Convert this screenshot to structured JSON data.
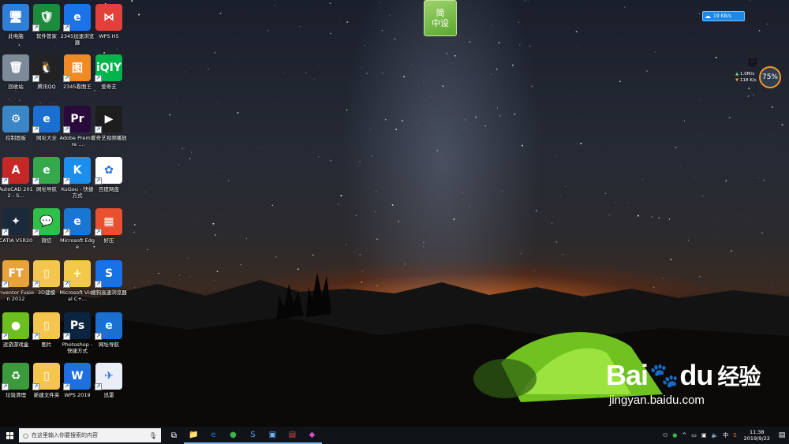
{
  "desktop": {
    "icons": [
      {
        "label": "此电脑",
        "icon": "computer-icon",
        "color": "#2f7fd8",
        "glyph": "🖥",
        "shortcut": false
      },
      {
        "label": "软件管家",
        "icon": "software-manager-icon",
        "color": "#1d8b3c",
        "glyph": "🛡",
        "shortcut": true
      },
      {
        "label": "2345加速浏览器",
        "icon": "browser-2345-icon",
        "color": "#1a73e8",
        "glyph": "e",
        "shortcut": true
      },
      {
        "label": "WPS H5",
        "icon": "wps-h5-icon",
        "color": "#e2413b",
        "glyph": "⋈",
        "shortcut": false
      },
      {
        "label": "回收站",
        "icon": "recycle-bin-icon",
        "color": "#7d8b99",
        "glyph": "🗑",
        "shortcut": false
      },
      {
        "label": "腾讯QQ",
        "icon": "qq-icon",
        "color": "#222222",
        "glyph": "🐧",
        "shortcut": true
      },
      {
        "label": "2345看图王",
        "icon": "image-viewer-2345-icon",
        "color": "#f08a24",
        "glyph": "图",
        "shortcut": true
      },
      {
        "label": "爱奇艺",
        "icon": "iqiyi-icon",
        "color": "#00b34a",
        "glyph": "iQIY",
        "shortcut": true
      },
      {
        "label": "控制面板",
        "icon": "control-panel-icon",
        "color": "#3b86c6",
        "glyph": "⚙",
        "shortcut": false
      },
      {
        "label": "网址大全",
        "icon": "ie-icon",
        "color": "#1a6fd0",
        "glyph": "e",
        "shortcut": true
      },
      {
        "label": "Adobe Premiere ...",
        "icon": "premiere-icon",
        "color": "#2a0a3a",
        "glyph": "Pr",
        "shortcut": true
      },
      {
        "label": "爱奇艺视频播放",
        "icon": "iqiyi-player-icon",
        "color": "#1d1d1d",
        "glyph": "▶",
        "shortcut": true
      },
      {
        "label": "AutoCAD 2012 - S...",
        "icon": "autocad-icon",
        "color": "#c62828",
        "glyph": "A",
        "shortcut": true
      },
      {
        "label": "网址导航",
        "icon": "web-nav-icon",
        "color": "#35a84c",
        "glyph": "e",
        "shortcut": true
      },
      {
        "label": "KuGou - 快捷方式",
        "icon": "kugou-icon",
        "color": "#1c8ef0",
        "glyph": "K",
        "shortcut": true
      },
      {
        "label": "百度网盘",
        "icon": "baidu-netdisk-icon",
        "color": "#ffffff",
        "glyph": "✿",
        "shortcut": true
      },
      {
        "label": "CATIA V5R20",
        "icon": "catia-icon",
        "color": "#1b2a3a",
        "glyph": "✦",
        "shortcut": true
      },
      {
        "label": "微信",
        "icon": "wechat-icon",
        "color": "#2ec04a",
        "glyph": "💬",
        "shortcut": true
      },
      {
        "label": "Microsoft Edge",
        "icon": "edge-icon",
        "color": "#1976d2",
        "glyph": "e",
        "shortcut": true
      },
      {
        "label": "好压",
        "icon": "haozip-icon",
        "color": "#e8502f",
        "glyph": "▦",
        "shortcut": true
      },
      {
        "label": "Inventor Fusion 2012",
        "icon": "inventor-icon",
        "color": "#e7a33a",
        "glyph": "FT",
        "shortcut": true
      },
      {
        "label": "3D建模",
        "icon": "folder-icon",
        "color": "#f4c64f",
        "glyph": "▯",
        "shortcut": true
      },
      {
        "label": "Microsoft Visual C+...",
        "icon": "visual-cpp-icon",
        "color": "#f3c94a",
        "glyph": "+",
        "shortcut": true
      },
      {
        "label": "搜狗高速浏览器",
        "icon": "sogou-browser-icon",
        "color": "#1672e6",
        "glyph": "S",
        "shortcut": true
      },
      {
        "label": "逗游游戏盒",
        "icon": "game-box-icon",
        "color": "#6bbf1f",
        "glyph": "●",
        "shortcut": true
      },
      {
        "label": "图片",
        "icon": "pictures-folder-icon",
        "color": "#f4c64f",
        "glyph": "▯",
        "shortcut": true
      },
      {
        "label": "Photoshop - 快捷方式",
        "icon": "photoshop-icon",
        "color": "#0b2440",
        "glyph": "Ps",
        "shortcut": true
      },
      {
        "label": "网址导航",
        "icon": "web-nav-ie-icon",
        "color": "#1a6fd0",
        "glyph": "e",
        "shortcut": true
      },
      {
        "label": "垃圾清理",
        "icon": "junk-cleaner-icon",
        "color": "#3b9a3b",
        "glyph": "♻",
        "shortcut": true
      },
      {
        "label": "新建文件夹",
        "icon": "new-folder-icon",
        "color": "#f4c64f",
        "glyph": "▯",
        "shortcut": true
      },
      {
        "label": "WPS 2019",
        "icon": "wps-2019-icon",
        "color": "#1e6fe0",
        "glyph": "W",
        "shortcut": true
      },
      {
        "label": "迅雷",
        "icon": "xunlei-icon",
        "color": "#e9eef7",
        "glyph": "✈",
        "shortcut": true
      }
    ]
  },
  "top_widget": {
    "line1": "简",
    "line2": "中设"
  },
  "net_float": {
    "speed": "19 KB/s"
  },
  "speed_widget": {
    "up": "1.0M/s",
    "down": "118 K/s",
    "percent": "75%"
  },
  "watermark": {
    "logo_left": "Bai",
    "logo_right": "du",
    "cn": "经验",
    "url": "jingyan.baidu.com"
  },
  "taskbar": {
    "search_placeholder": "在这里输入你要搜索的内容",
    "apps": [
      {
        "icon": "task-view-icon",
        "glyph": "⧉",
        "color": "#ffffff",
        "active": false
      },
      {
        "icon": "file-explorer-icon",
        "glyph": "📁",
        "color": "#f4c64f",
        "active": true
      },
      {
        "icon": "browser-2345-taskbar-icon",
        "glyph": "e",
        "color": "#1a73e8",
        "active": true
      },
      {
        "icon": "green-app-icon",
        "glyph": "●",
        "color": "#3bb54a",
        "active": true
      },
      {
        "icon": "sogou-taskbar-icon",
        "glyph": "S",
        "color": "#4aa3ff",
        "active": true
      },
      {
        "icon": "window-app-icon",
        "glyph": "▣",
        "color": "#6fb4ff",
        "active": true
      },
      {
        "icon": "red-window-icon",
        "glyph": "▤",
        "color": "#e04848",
        "active": true
      },
      {
        "icon": "map-pin-icon",
        "glyph": "◆",
        "color": "#d94cc8",
        "active": true
      }
    ],
    "tray": {
      "ime": "中",
      "time": "11:38",
      "date": "2019/9/22"
    }
  }
}
